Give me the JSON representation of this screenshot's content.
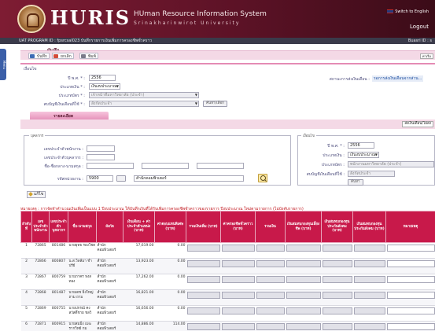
{
  "header": {
    "brand": "HURIS",
    "subtitle1": "HUman Resource Information System",
    "subtitle2": "Srinakharinwirot University",
    "lang": "Switch to English",
    "logout": "Logout"
  },
  "subheader": {
    "program": "UAT  PROGRAM ID : fpsrcsal023 บันทึกรายการเงินเพิ่มการครองชีพชั่วคราว",
    "user": "Buasri ID : s"
  },
  "side_tab": "Menu",
  "function_panel": {
    "title": "บันทึก",
    "buttons": {
      "save": "บันทึก",
      "cancel": "ยกเลิก",
      "print": "พิมพ์"
    },
    "right": "ค่าเริ่ม"
  },
  "condition_section": {
    "heading": "เงื่อนไข",
    "year_label": "ปี พ.ศ. * :",
    "year_value": "2556",
    "type_label": "ประเภทเงิน * :",
    "type_value": "เงินงบประมาณ",
    "org_label": "ประเภทบัตร * :",
    "org_value": "เจ้าหน้าที่มหาวิทยาลัย (ประจำ)",
    "unit_label": "สบบัญชีเงินเดือนที่ใช้ * :",
    "unit_value": "สังกัดประจำ",
    "unit_btn": "ค้นหา/เลือก",
    "right_label": "สถานะการส่งเงินเดือน :",
    "right_link": "รอการส่งเงินเดือนจากส่วน..."
  },
  "list_section": {
    "tab": "รายละเอียด",
    "bar_btn": "ส่งเงินเดือน/ไม่ส่ง"
  },
  "search": {
    "legend": "บุคลากร",
    "staff_id_label": "เลขประจำตัวพนักงาน :",
    "citizen_label": "เลขประจำตัวบุคลากร :",
    "name_label": "ชื่อ-ชื่อกลาง-นามสกุล :",
    "dept_label": "รหัสหน่วยงาน :",
    "dept_code": "5900",
    "dept_name": "สำนักคอมพิวเตอร์",
    "legend2": "เงื่อนไข",
    "year_label": "ปี พ.ศ. * :",
    "year_value": "2556",
    "type_label": "ประเภทเงิน :",
    "type_value": "เงินงบประมาณ",
    "staff_type_label": "ประเภทบัตร :",
    "staff_type_value": "พนักงานมหาวิทยาลัย (ประจำ)",
    "salary_label": "สบบัญชีเงินเดือนที่ใช้ :",
    "salary_value": "สังกัดประจำ",
    "find_btn": "ค้นหา"
  },
  "edit_button": "แก้ไข",
  "red_note": "หมายเหตุ : การจัดทำคำนวณเงินเพิ่มเป็นแบบ 1 ปีงบประมาณ ให้บันทึกเงินที่ได้รับเพิ่มการครองชีพชั่วคราวของรายการ ปีงบประมาณ ใหม่ตามรายการ (ไม่บังคับรายการ)",
  "table": {
    "headers": [
      "ลำดับที่",
      "เลขประจำตัวพนักงาน",
      "เลขประจำตัวบุคลากร",
      "ชื่อ-นามสกุล",
      "สังกัด",
      "เงินเดือน + ค่าประจำตำแหน่ง (บาท)",
      "ค่าตอบแทนพิเศษ (บาท)",
      "รวมเงินเพิ่ม (บาท)",
      "ค่าครองชีพชั่วคราว (บาท)",
      "รวมเงิน",
      "เงินสมทบกองทุนเลี้ยงชีพ (บาท)",
      "เงินสมทบกองทุนประกันสังคม (บาท)",
      "เงินสมทบกองทุนประกันสังคม (บาท)",
      "หมายเหตุ"
    ],
    "rows": [
      [
        "1",
        "72865",
        "801486",
        "นายยุทธ รองโชด",
        "สำนัก คอมพิวเตอร์",
        "17,619.00",
        "0.00"
      ],
      [
        "2",
        "72866",
        "800807",
        "น.ส.วิลลีมา ชำปรีย์",
        "สำนัก คอมพิวเตอร์",
        "13,923.00",
        "0.00"
      ],
      [
        "3",
        "72867",
        "800759",
        "นายภาคร หงสทอง",
        "สำนัก คอมพิวเตอร์",
        "17,262.00",
        "0.00"
      ],
      [
        "4",
        "72868",
        "801487",
        "นายเดช ยิ่งใหญ่ ถาม ถาม",
        "สำนัก คอมพิวเตอร์",
        "16,821.00",
        "0.00"
      ],
      [
        "5",
        "72869",
        "800755",
        "นายปกรณ์ คงสวัสดิ์ชาย ชลวิ",
        "สำนัก คอมพิวเตอร์",
        "16,656.00",
        "0.00"
      ],
      [
        "6",
        "72871",
        "800915",
        "นายสมมิ่ง เมฆรากวิทย์ กม",
        "สำนัก คอมพิวเตอร์",
        "14,886.00",
        "114.00"
      ]
    ]
  },
  "colors": {
    "header_bg": "#7e1c33",
    "table_header": "#c8194a",
    "pink_bar": "#f4d9e6",
    "note_red": "#c0161d"
  }
}
